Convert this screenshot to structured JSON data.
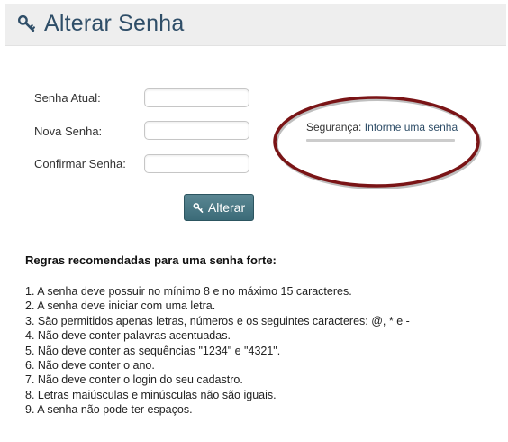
{
  "header": {
    "title": "Alterar Senha",
    "icon": "key-icon"
  },
  "form": {
    "current_password_label": "Senha Atual:",
    "current_password_value": "",
    "new_password_label": "Nova Senha:",
    "new_password_value": "",
    "confirm_password_label": "Confirmar Senha:",
    "confirm_password_value": "",
    "submit_label": "Alterar",
    "submit_icon": "key-icon"
  },
  "strength": {
    "label": "Segurança:",
    "value": "Informe uma senha"
  },
  "rules": {
    "title": "Regras recomendadas para uma senha forte:",
    "items": [
      "1. A senha deve possuir no mínimo 8 e no máximo 15 caracteres.",
      "2. A senha deve iniciar com uma letra.",
      "3. São permitidos apenas letras, números e os seguintes caracteres: @, * e -",
      "4. Não deve conter palavras acentuadas.",
      "5. Não deve conter as sequências \"1234\" e \"4321\".",
      "6. Não deve conter o ano.",
      "7. Não deve conter o login do seu cadastro.",
      "8. Letras maiúsculas e minúsculas não são iguais.",
      "9. A senha não pode ter espaços."
    ]
  },
  "colors": {
    "title": "#2f4e68",
    "button": "#3b6b78",
    "highlight": "#7a1416"
  }
}
